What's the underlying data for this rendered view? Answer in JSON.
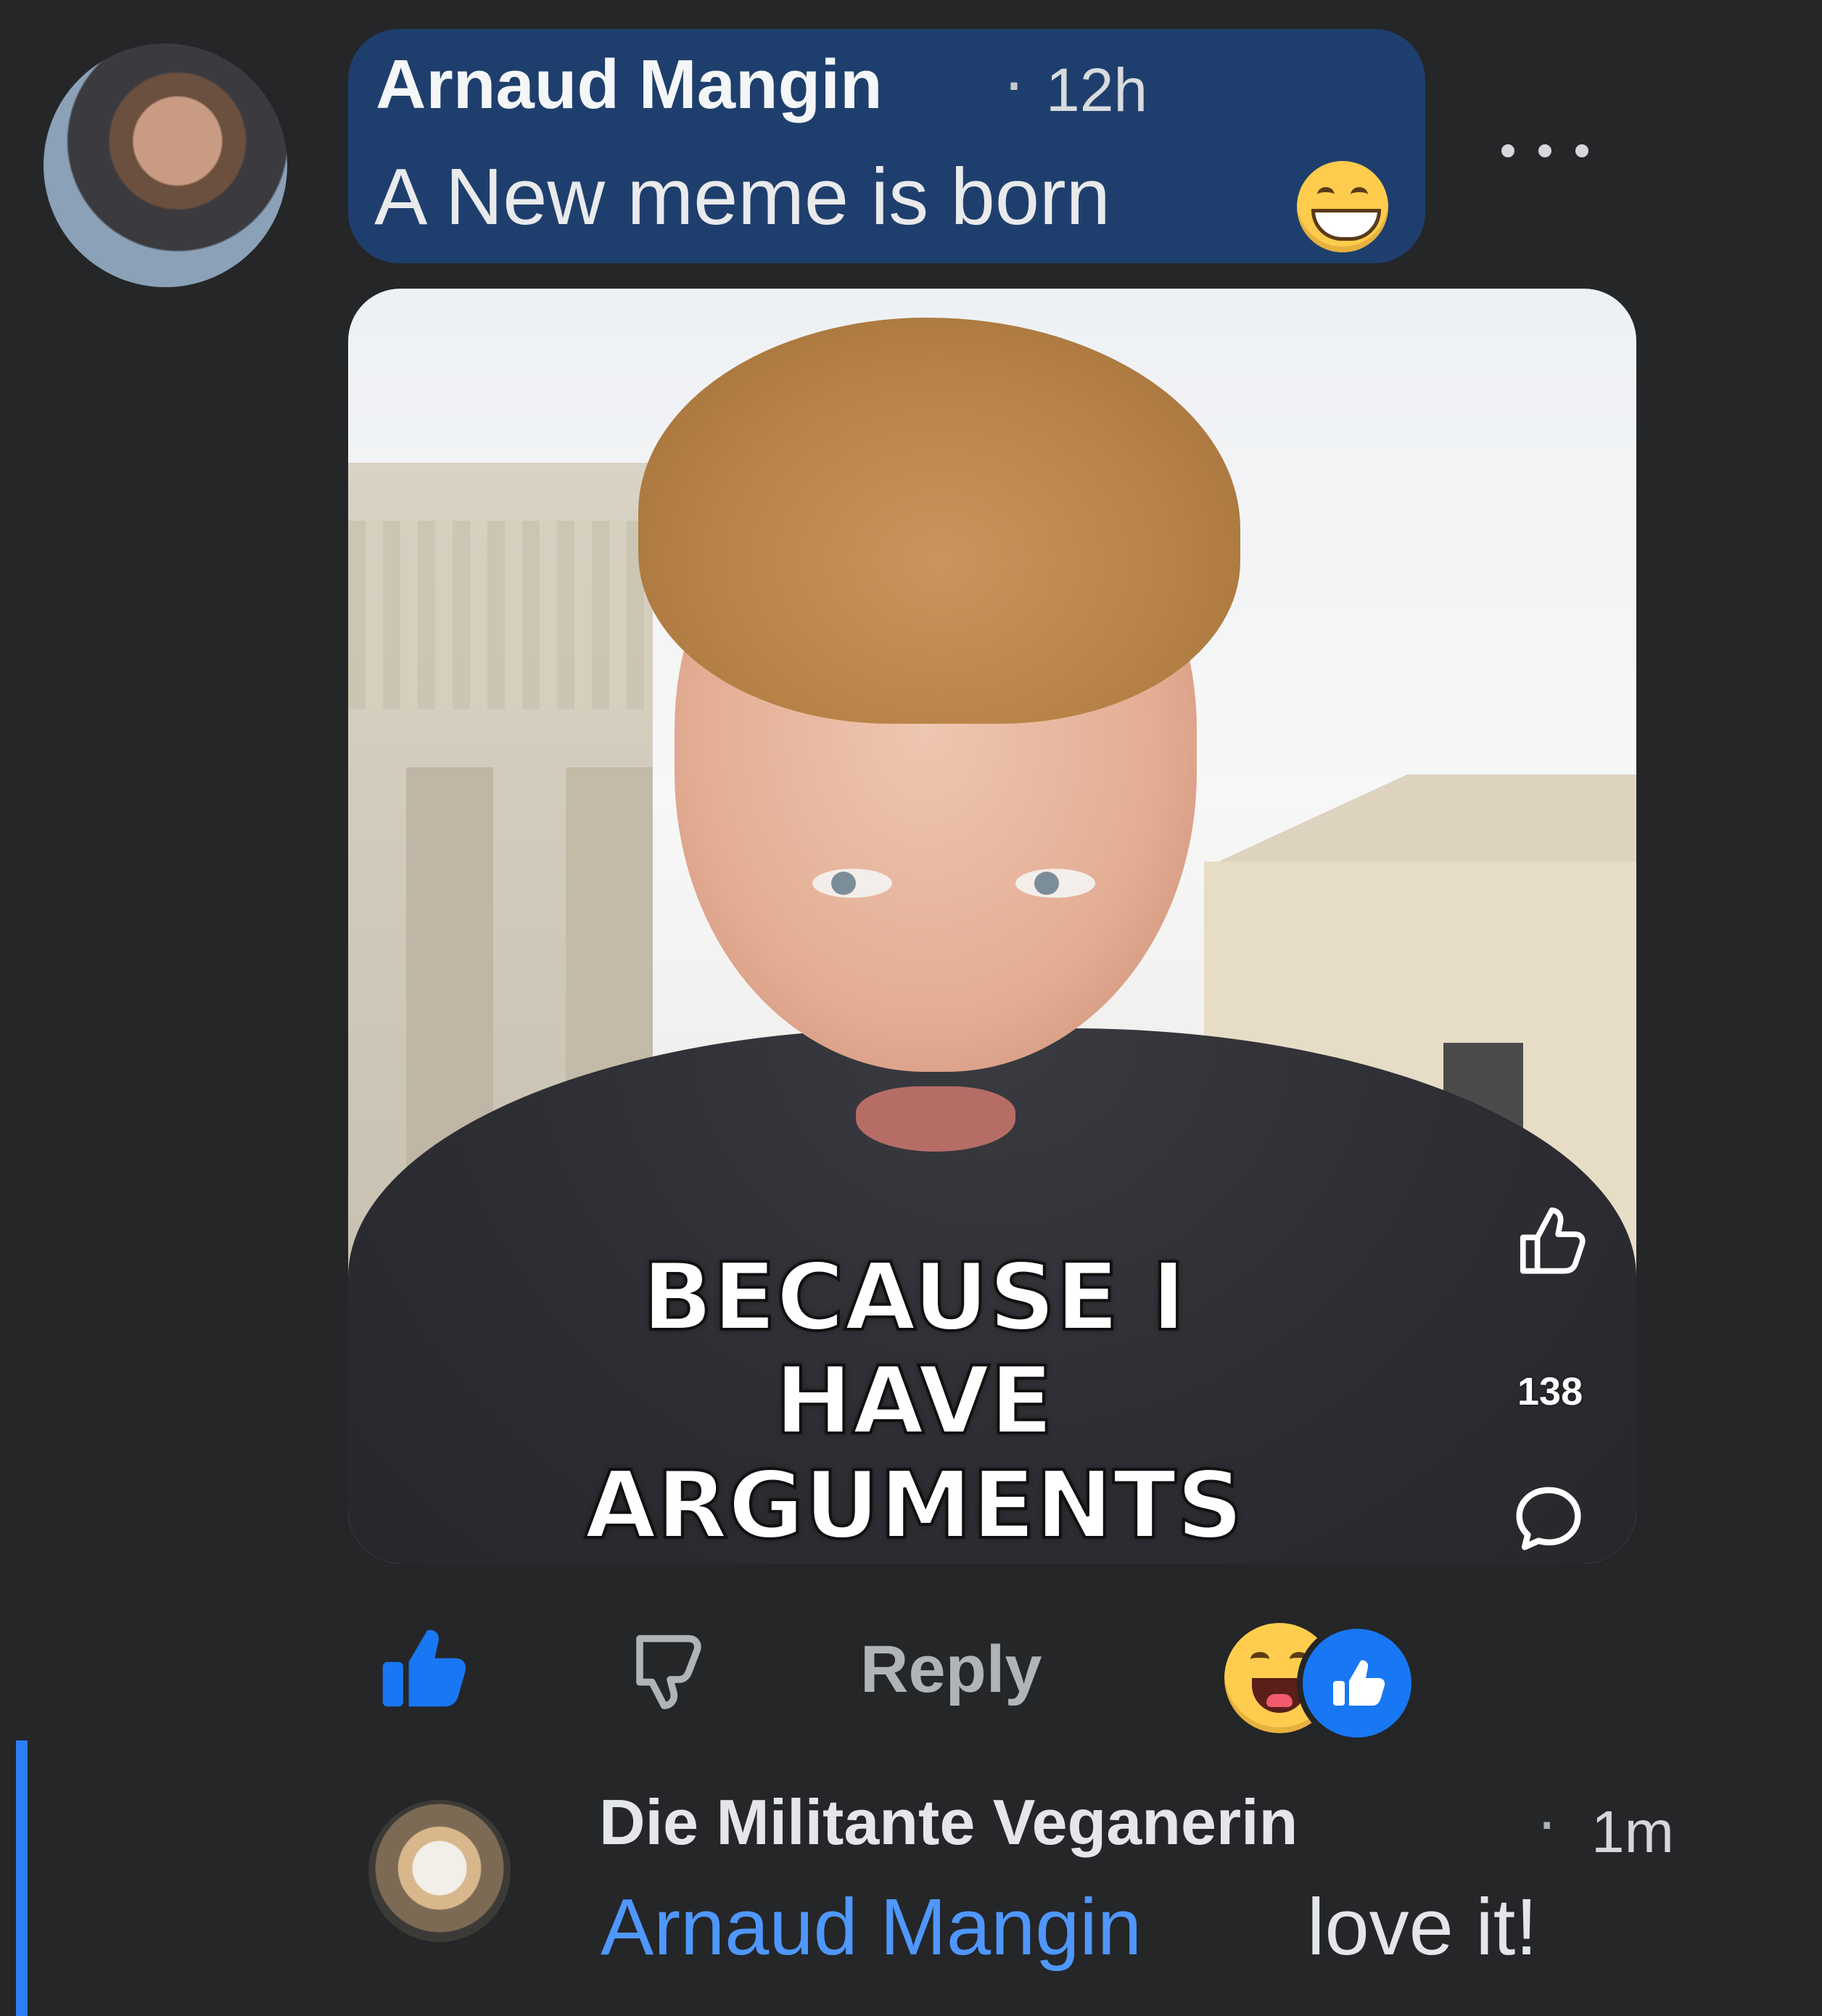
{
  "comment": {
    "author": "Arnaud Mangin",
    "separator": "·",
    "time": "12h",
    "text": "A New meme is born",
    "emoji": "grinning-face-emoji"
  },
  "meme": {
    "caption_line1": "BECAUSE I",
    "caption_line2": "HAVE ARGUMENTS",
    "like_count": "138"
  },
  "actions": {
    "reply_label": "Reply"
  },
  "reply": {
    "author": "Die Militante Veganerin",
    "separator": "·",
    "time": "1m",
    "mention": "Arnaud Mangin",
    "text": "love it!"
  },
  "icons": {
    "like": "like-icon",
    "dislike": "dislike-icon",
    "comment": "comment-icon",
    "more": "more-icon"
  },
  "colors": {
    "background": "#252628",
    "bubble": "#1e3f6d",
    "accent": "#1877f2",
    "mention": "#4f97ff",
    "reply_bar": "#2d7ff9"
  }
}
